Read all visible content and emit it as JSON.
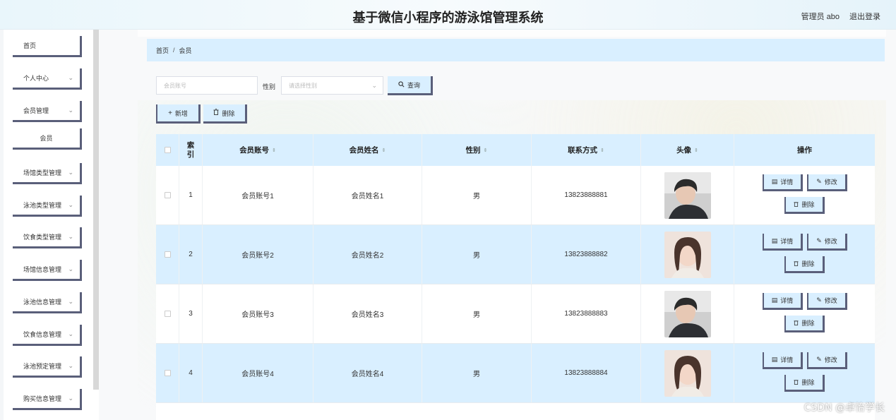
{
  "header": {
    "title": "基于微信小程序的游泳馆管理系统",
    "user": "管理员 abo",
    "logout": "退出登录"
  },
  "sidebar": {
    "items": [
      {
        "label": "首页",
        "chevron": false
      },
      {
        "label": "个人中心",
        "chevron": true
      },
      {
        "label": "会员管理",
        "chevron": true
      },
      {
        "label": "会员",
        "chevron": false,
        "sub": true
      },
      {
        "label": "场馆类型管理",
        "chevron": true
      },
      {
        "label": "泳池类型管理",
        "chevron": true
      },
      {
        "label": "饮食类型管理",
        "chevron": true
      },
      {
        "label": "场馆信息管理",
        "chevron": true
      },
      {
        "label": "泳池信息管理",
        "chevron": true
      },
      {
        "label": "饮食信息管理",
        "chevron": true
      },
      {
        "label": "泳池预定管理",
        "chevron": true
      },
      {
        "label": "购买信息管理",
        "chevron": true
      }
    ]
  },
  "breadcrumb": {
    "home": "首页",
    "separator": "/",
    "current": "会员"
  },
  "search": {
    "account_placeholder": "会员账号",
    "gender_label": "性别",
    "gender_placeholder": "请选择性别",
    "query_label": "查询"
  },
  "actions": {
    "add_label": "新增",
    "delete_label": "删除"
  },
  "table": {
    "headers": {
      "index": "索引",
      "account": "会员账号",
      "name": "会员姓名",
      "gender": "性别",
      "contact": "联系方式",
      "avatar": "头像",
      "ops": "操作"
    },
    "op_labels": {
      "detail": "详情",
      "edit": "修改",
      "delete": "删除"
    },
    "rows": [
      {
        "index": "1",
        "account": "会员账号1",
        "name": "会员姓名1",
        "gender": "男",
        "contact": "13823888881",
        "avatar": "male-avatar"
      },
      {
        "index": "2",
        "account": "会员账号2",
        "name": "会员姓名2",
        "gender": "男",
        "contact": "13823888882",
        "avatar": "female-avatar"
      },
      {
        "index": "3",
        "account": "会员账号3",
        "name": "会员姓名3",
        "gender": "男",
        "contact": "13823888883",
        "avatar": "male-avatar"
      },
      {
        "index": "4",
        "account": "会员账号4",
        "name": "会员姓名4",
        "gender": "男",
        "contact": "13823888884",
        "avatar": "female-avatar"
      }
    ]
  },
  "watermark": "CSDN @卓怡学长",
  "colors": {
    "accent": "#d9efff",
    "button_border": "#5a5f7a"
  }
}
